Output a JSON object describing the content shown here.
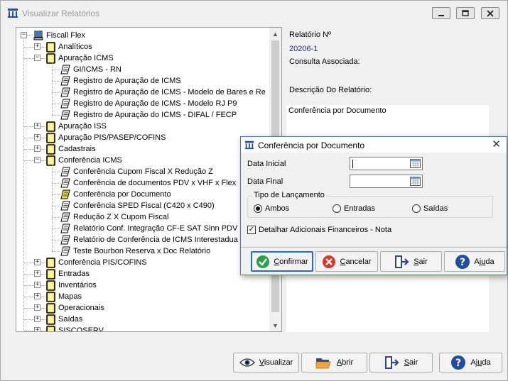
{
  "window": {
    "title": "Visualizar Relatórios"
  },
  "tree": {
    "root": "Fiscall Flex",
    "items": [
      {
        "label": "Analíticos",
        "kind": "folder",
        "level": 1,
        "expanded": false
      },
      {
        "label": "Apuração ICMS",
        "kind": "folder",
        "level": 1,
        "expanded": true
      },
      {
        "label": "GI/ICMS - RN",
        "kind": "report",
        "level": 2
      },
      {
        "label": "Registro de Apuração de ICMS",
        "kind": "report",
        "level": 2
      },
      {
        "label": "Registro de Apuração de ICMS - Modelo de Bares e Re",
        "kind": "report",
        "level": 2
      },
      {
        "label": "Registro de Apuração de ICMS - Modelo RJ P9",
        "kind": "report",
        "level": 2
      },
      {
        "label": "Registro de Apuração do ICMS - DIFAL / FECP",
        "kind": "report",
        "level": 2
      },
      {
        "label": "Apuração ISS",
        "kind": "folder",
        "level": 1,
        "expanded": false
      },
      {
        "label": "Apuração PIS/PASEP/COFINS",
        "kind": "folder",
        "level": 1,
        "expanded": false
      },
      {
        "label": "Cadastrais",
        "kind": "folder",
        "level": 1,
        "expanded": false
      },
      {
        "label": "Conferência ICMS",
        "kind": "folder",
        "level": 1,
        "expanded": true
      },
      {
        "label": "Conferência Cupom Fiscal X Redução Z",
        "kind": "report",
        "level": 2
      },
      {
        "label": "Conferência de documentos PDV x VHF x Flex",
        "kind": "report",
        "level": 2
      },
      {
        "label": "Conferência por Documento",
        "kind": "report",
        "level": 2,
        "selected": true
      },
      {
        "label": "Conferência SPED Fiscal (C420 x C490)",
        "kind": "report",
        "level": 2
      },
      {
        "label": "Redução Z   X   Cupom Fiscal",
        "kind": "report",
        "level": 2
      },
      {
        "label": "Relatório Conf. Integração CF-E SAT Sinn PDV (",
        "kind": "report",
        "level": 2
      },
      {
        "label": "Relatório de Conferência de ICMS Interestadua",
        "kind": "report",
        "level": 2
      },
      {
        "label": "Teste Bourbon Reserva x Doc Relatório",
        "kind": "report",
        "level": 2
      },
      {
        "label": "Conferência PIS/COFINS",
        "kind": "folder",
        "level": 1,
        "expanded": false
      },
      {
        "label": "Entradas",
        "kind": "folder",
        "level": 1,
        "expanded": false
      },
      {
        "label": "Inventários",
        "kind": "folder",
        "level": 1,
        "expanded": false
      },
      {
        "label": "Mapas",
        "kind": "folder",
        "level": 1,
        "expanded": false
      },
      {
        "label": "Operacionais",
        "kind": "folder",
        "level": 1,
        "expanded": false
      },
      {
        "label": "Saídas",
        "kind": "folder",
        "level": 1,
        "expanded": false
      },
      {
        "label": "SISCOSERV",
        "kind": "folder",
        "level": 1,
        "expanded": false
      }
    ]
  },
  "info": {
    "report_no_label": "Relatório Nº",
    "report_no_value": "20206-1",
    "consulta_label": "Consulta Associada:",
    "descricao_label": "Descrição Do Relatório:",
    "descricao_value": "Conferência por Documento"
  },
  "bottom_buttons": {
    "visualizar": {
      "hot": "V",
      "rest": "isualizar"
    },
    "abrir": {
      "hot": "A",
      "rest": "brir"
    },
    "sair": {
      "hot": "S",
      "rest": "air"
    },
    "ajuda": {
      "pre": "Aj",
      "hot": "u",
      "rest": "da"
    }
  },
  "dialog": {
    "title": "Conferência por Documento",
    "data_inicial_label": "Data Inicial",
    "data_inicial_value": "",
    "data_final_label": "Data Final",
    "data_final_value": "",
    "tipo_lancamento_label": "Tipo de Lançamento",
    "radios": [
      {
        "label": "Ambos",
        "checked": true
      },
      {
        "label": "Entradas",
        "checked": false
      },
      {
        "label": "Saídas",
        "checked": false
      }
    ],
    "detalhar_label": "Detalhar Adicionais Financeiros - Nota",
    "detalhar_checked": true,
    "buttons": {
      "confirmar": {
        "hot": "C",
        "rest": "onfirmar"
      },
      "cancelar": {
        "hot": "C",
        "rest": "ancelar"
      },
      "sair": {
        "hot": "S",
        "rest": "air"
      },
      "ajuda": {
        "pre": "Aj",
        "hot": "u",
        "rest": "da"
      }
    }
  },
  "colors": {
    "folder_fill": "#f7e04a",
    "folder_edge": "#000000",
    "link_blue": "#2a2a7c",
    "focus_blue": "#2a6ad0",
    "confirm_green": "#2e9e48",
    "cancel_red": "#d9362b",
    "help_blue": "#1f4e9e"
  }
}
